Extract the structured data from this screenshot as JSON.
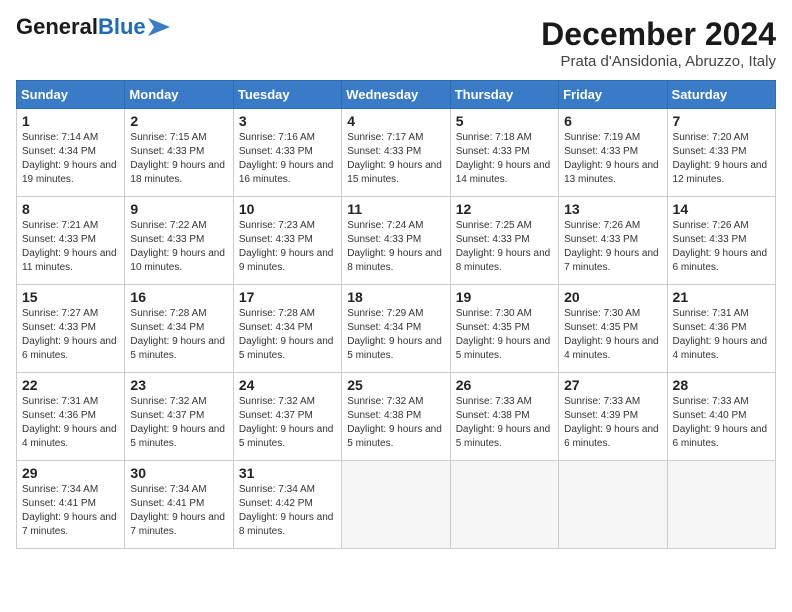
{
  "header": {
    "logo_general": "General",
    "logo_blue": "Blue",
    "month_title": "December 2024",
    "location": "Prata d'Ansidonia, Abruzzo, Italy"
  },
  "days_of_week": [
    "Sunday",
    "Monday",
    "Tuesday",
    "Wednesday",
    "Thursday",
    "Friday",
    "Saturday"
  ],
  "weeks": [
    [
      {
        "day": 1,
        "sunrise": "7:14 AM",
        "sunset": "4:34 PM",
        "daylight": "9 hours and 19 minutes."
      },
      {
        "day": 2,
        "sunrise": "7:15 AM",
        "sunset": "4:33 PM",
        "daylight": "9 hours and 18 minutes."
      },
      {
        "day": 3,
        "sunrise": "7:16 AM",
        "sunset": "4:33 PM",
        "daylight": "9 hours and 16 minutes."
      },
      {
        "day": 4,
        "sunrise": "7:17 AM",
        "sunset": "4:33 PM",
        "daylight": "9 hours and 15 minutes."
      },
      {
        "day": 5,
        "sunrise": "7:18 AM",
        "sunset": "4:33 PM",
        "daylight": "9 hours and 14 minutes."
      },
      {
        "day": 6,
        "sunrise": "7:19 AM",
        "sunset": "4:33 PM",
        "daylight": "9 hours and 13 minutes."
      },
      {
        "day": 7,
        "sunrise": "7:20 AM",
        "sunset": "4:33 PM",
        "daylight": "9 hours and 12 minutes."
      }
    ],
    [
      {
        "day": 8,
        "sunrise": "7:21 AM",
        "sunset": "4:33 PM",
        "daylight": "9 hours and 11 minutes."
      },
      {
        "day": 9,
        "sunrise": "7:22 AM",
        "sunset": "4:33 PM",
        "daylight": "9 hours and 10 minutes."
      },
      {
        "day": 10,
        "sunrise": "7:23 AM",
        "sunset": "4:33 PM",
        "daylight": "9 hours and 9 minutes."
      },
      {
        "day": 11,
        "sunrise": "7:24 AM",
        "sunset": "4:33 PM",
        "daylight": "9 hours and 8 minutes."
      },
      {
        "day": 12,
        "sunrise": "7:25 AM",
        "sunset": "4:33 PM",
        "daylight": "9 hours and 8 minutes."
      },
      {
        "day": 13,
        "sunrise": "7:26 AM",
        "sunset": "4:33 PM",
        "daylight": "9 hours and 7 minutes."
      },
      {
        "day": 14,
        "sunrise": "7:26 AM",
        "sunset": "4:33 PM",
        "daylight": "9 hours and 6 minutes."
      }
    ],
    [
      {
        "day": 15,
        "sunrise": "7:27 AM",
        "sunset": "4:33 PM",
        "daylight": "9 hours and 6 minutes."
      },
      {
        "day": 16,
        "sunrise": "7:28 AM",
        "sunset": "4:34 PM",
        "daylight": "9 hours and 5 minutes."
      },
      {
        "day": 17,
        "sunrise": "7:28 AM",
        "sunset": "4:34 PM",
        "daylight": "9 hours and 5 minutes."
      },
      {
        "day": 18,
        "sunrise": "7:29 AM",
        "sunset": "4:34 PM",
        "daylight": "9 hours and 5 minutes."
      },
      {
        "day": 19,
        "sunrise": "7:30 AM",
        "sunset": "4:35 PM",
        "daylight": "9 hours and 5 minutes."
      },
      {
        "day": 20,
        "sunrise": "7:30 AM",
        "sunset": "4:35 PM",
        "daylight": "9 hours and 4 minutes."
      },
      {
        "day": 21,
        "sunrise": "7:31 AM",
        "sunset": "4:36 PM",
        "daylight": "9 hours and 4 minutes."
      }
    ],
    [
      {
        "day": 22,
        "sunrise": "7:31 AM",
        "sunset": "4:36 PM",
        "daylight": "9 hours and 4 minutes."
      },
      {
        "day": 23,
        "sunrise": "7:32 AM",
        "sunset": "4:37 PM",
        "daylight": "9 hours and 5 minutes."
      },
      {
        "day": 24,
        "sunrise": "7:32 AM",
        "sunset": "4:37 PM",
        "daylight": "9 hours and 5 minutes."
      },
      {
        "day": 25,
        "sunrise": "7:32 AM",
        "sunset": "4:38 PM",
        "daylight": "9 hours and 5 minutes."
      },
      {
        "day": 26,
        "sunrise": "7:33 AM",
        "sunset": "4:38 PM",
        "daylight": "9 hours and 5 minutes."
      },
      {
        "day": 27,
        "sunrise": "7:33 AM",
        "sunset": "4:39 PM",
        "daylight": "9 hours and 6 minutes."
      },
      {
        "day": 28,
        "sunrise": "7:33 AM",
        "sunset": "4:40 PM",
        "daylight": "9 hours and 6 minutes."
      }
    ],
    [
      {
        "day": 29,
        "sunrise": "7:34 AM",
        "sunset": "4:41 PM",
        "daylight": "9 hours and 7 minutes."
      },
      {
        "day": 30,
        "sunrise": "7:34 AM",
        "sunset": "4:41 PM",
        "daylight": "9 hours and 7 minutes."
      },
      {
        "day": 31,
        "sunrise": "7:34 AM",
        "sunset": "4:42 PM",
        "daylight": "9 hours and 8 minutes."
      },
      null,
      null,
      null,
      null
    ]
  ]
}
